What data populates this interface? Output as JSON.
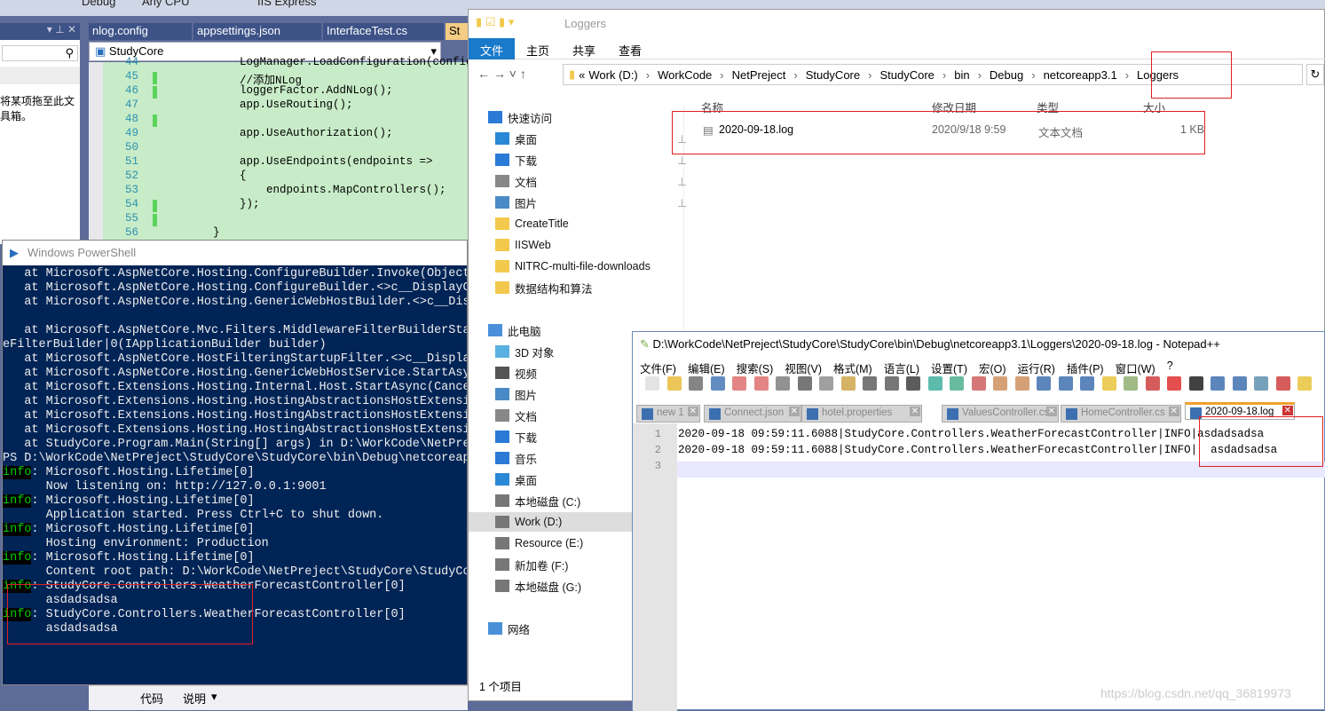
{
  "vs": {
    "toolbar": {
      "config": "Debug",
      "platform": "Any CPU",
      "run": "IIS Express"
    },
    "tabs": [
      "nlog.config",
      "appsettings.json",
      "InterfaceTest.cs",
      "St"
    ],
    "project_combo": "StudyCore",
    "toolbox_hint": [
      "将某项拖至此文",
      "具箱。"
    ],
    "code_lines": [
      {
        "n": "44",
        "t": "            LogManager.LoadConfiguration(config"
      },
      {
        "n": "45",
        "t": "            //添加NLog"
      },
      {
        "n": "46",
        "t": "            loggerFactor.AddNLog();"
      },
      {
        "n": "47",
        "t": "            app.UseRouting();"
      },
      {
        "n": "48",
        "t": ""
      },
      {
        "n": "49",
        "t": "            app.UseAuthorization();"
      },
      {
        "n": "50",
        "t": ""
      },
      {
        "n": "51",
        "t": "            app.UseEndpoints(endpoints =>"
      },
      {
        "n": "52",
        "t": "            {"
      },
      {
        "n": "53",
        "t": "                endpoints.MapControllers();"
      },
      {
        "n": "54",
        "t": "            });"
      },
      {
        "n": "55",
        "t": ""
      },
      {
        "n": "56",
        "t": "        }"
      }
    ],
    "bottom": {
      "code_col": "代码",
      "desc_col": "说明"
    }
  },
  "powershell": {
    "title": "Windows PowerShell",
    "lines": [
      {
        "t": "   at Microsoft.AspNetCore.Hosting.ConfigureBuilder.Invoke(Object"
      },
      {
        "t": "   at Microsoft.AspNetCore.Hosting.ConfigureBuilder.<>c__DisplayCl"
      },
      {
        "t": "   at Microsoft.AspNetCore.Hosting.GenericWebHostBuilder.<>c__Disp"
      },
      {
        "t": ""
      },
      {
        "t": "   at Microsoft.AspNetCore.Mvc.Filters.MiddlewareFilterBuilderStar"
      },
      {
        "t": "eFilterBuilder|0(IApplicationBuilder builder)"
      },
      {
        "t": "   at Microsoft.AspNetCore.HostFilteringStartupFilter.<>c__Display"
      },
      {
        "t": "   at Microsoft.AspNetCore.Hosting.GenericWebHostService.StartAsyn"
      },
      {
        "t": "   at Microsoft.Extensions.Hosting.Internal.Host.StartAsync(Cancel"
      },
      {
        "t": "   at Microsoft.Extensions.Hosting.HostingAbstractionsHostExtensio"
      },
      {
        "t": "   at Microsoft.Extensions.Hosting.HostingAbstractionsHostExtensio"
      },
      {
        "t": "   at Microsoft.Extensions.Hosting.HostingAbstractionsHostExtensio"
      },
      {
        "t": "   at StudyCore.Program.Main(String[] args) in D:\\WorkCode\\NetPrej"
      },
      {
        "t": "PS D:\\WorkCode\\NetPreject\\StudyCore\\StudyCore\\bin\\Debug\\netcoreapp"
      },
      {
        "p": "info",
        "t": ": Microsoft.Hosting.Lifetime[0]"
      },
      {
        "t": "      Now listening on: http://127.0.0.1:9001"
      },
      {
        "p": "info",
        "t": ": Microsoft.Hosting.Lifetime[0]"
      },
      {
        "t": "      Application started. Press Ctrl+C to shut down."
      },
      {
        "p": "info",
        "t": ": Microsoft.Hosting.Lifetime[0]"
      },
      {
        "t": "      Hosting environment: Production"
      },
      {
        "p": "info",
        "t": ": Microsoft.Hosting.Lifetime[0]"
      },
      {
        "t": "      Content root path: D:\\WorkCode\\NetPreject\\StudyCore\\StudyCor"
      },
      {
        "p": "info",
        "t": ": StudyCore.Controllers.WeatherForecastController[0]"
      },
      {
        "t": "      asdadsadsa"
      },
      {
        "p": "info",
        "t": ": StudyCore.Controllers.WeatherForecastController[0]"
      },
      {
        "t": "      asdadsadsa"
      }
    ]
  },
  "explorer": {
    "title": "Loggers",
    "ribbon": [
      "文件",
      "主页",
      "共享",
      "查看"
    ],
    "breadcrumb_prefix": "«",
    "breadcrumb": [
      "Work (D:)",
      "WorkCode",
      "NetPreject",
      "StudyCore",
      "StudyCore",
      "bin",
      "Debug",
      "netcoreapp3.1",
      "Loggers"
    ],
    "columns": [
      "名称",
      "修改日期",
      "类型",
      "大小"
    ],
    "files": [
      {
        "name": "2020-09-18.log",
        "date": "2020/9/18 9:59",
        "type": "文本文档",
        "size": "1 KB"
      }
    ],
    "nav": [
      {
        "label": "快速访问",
        "icon": "star-icon",
        "lvl": 0
      },
      {
        "label": "桌面",
        "icon": "desktop-icon",
        "lvl": 1,
        "pin": true
      },
      {
        "label": "下载",
        "icon": "download-icon",
        "lvl": 1,
        "pin": true
      },
      {
        "label": "文档",
        "icon": "document-icon",
        "lvl": 1,
        "pin": true
      },
      {
        "label": "图片",
        "icon": "picture-icon",
        "lvl": 1,
        "pin": true
      },
      {
        "label": "CreateTitle",
        "icon": "folder-icon",
        "lvl": 1
      },
      {
        "label": "IISWeb",
        "icon": "folder-icon",
        "lvl": 1
      },
      {
        "label": "NITRC-multi-file-downloads",
        "icon": "folder-icon",
        "lvl": 1
      },
      {
        "label": "数据结构和算法",
        "icon": "folder-icon",
        "lvl": 1
      },
      {
        "label": "",
        "icon": "",
        "lvl": 1
      },
      {
        "label": "此电脑",
        "icon": "computer-icon",
        "lvl": 0
      },
      {
        "label": "3D 对象",
        "icon": "cube-icon",
        "lvl": 1
      },
      {
        "label": "视频",
        "icon": "video-icon",
        "lvl": 1
      },
      {
        "label": "图片",
        "icon": "picture-icon",
        "lvl": 1
      },
      {
        "label": "文档",
        "icon": "document-icon",
        "lvl": 1
      },
      {
        "label": "下载",
        "icon": "download-icon",
        "lvl": 1
      },
      {
        "label": "音乐",
        "icon": "music-icon",
        "lvl": 1
      },
      {
        "label": "桌面",
        "icon": "desktop-icon",
        "lvl": 1
      },
      {
        "label": "本地磁盘 (C:)",
        "icon": "drive-icon",
        "lvl": 1
      },
      {
        "label": "Work (D:)",
        "icon": "drive-icon",
        "lvl": 1,
        "selected": true
      },
      {
        "label": "Resource (E:)",
        "icon": "drive-icon",
        "lvl": 1
      },
      {
        "label": "新加卷 (F:)",
        "icon": "drive-icon",
        "lvl": 1
      },
      {
        "label": "本地磁盘 (G:)",
        "icon": "drive-icon",
        "lvl": 1
      },
      {
        "label": "",
        "icon": "",
        "lvl": 1
      },
      {
        "label": "网络",
        "icon": "network-icon",
        "lvl": 0
      }
    ],
    "status": "1 个项目"
  },
  "notepad": {
    "title": "D:\\WorkCode\\NetPreject\\StudyCore\\StudyCore\\bin\\Debug\\netcoreapp3.1\\Loggers\\2020-09-18.log - Notepad++",
    "menu": [
      "文件(F)",
      "编辑(E)",
      "搜索(S)",
      "视图(V)",
      "格式(M)",
      "语言(L)",
      "设置(T)",
      "宏(O)",
      "运行(R)",
      "插件(P)",
      "窗口(W)",
      "?"
    ],
    "tabs": [
      "new  1",
      "Connect.json",
      "hotel.properties",
      "ValuesController.cs",
      "HomeController.cs",
      "2020-09-18.log"
    ],
    "active_tab": 5,
    "lines": [
      {
        "n": "1",
        "t": "2020-09-18 09:59:11.6088|StudyCore.Controllers.WeatherForecastController|INFO|asdadsadsa"
      },
      {
        "n": "2",
        "t": "2020-09-18 09:59:11.6088|StudyCore.Controllers.WeatherForecastController|INFO|  asdadsadsa"
      },
      {
        "n": "3",
        "t": ""
      }
    ]
  },
  "watermark": "https://blog.csdn.net/qq_36819973",
  "colors": {
    "ps_bg": "#012456",
    "highlight": "#e02020",
    "explorer_accent": "#1979ca",
    "code_bg": "#c8ecc8"
  }
}
